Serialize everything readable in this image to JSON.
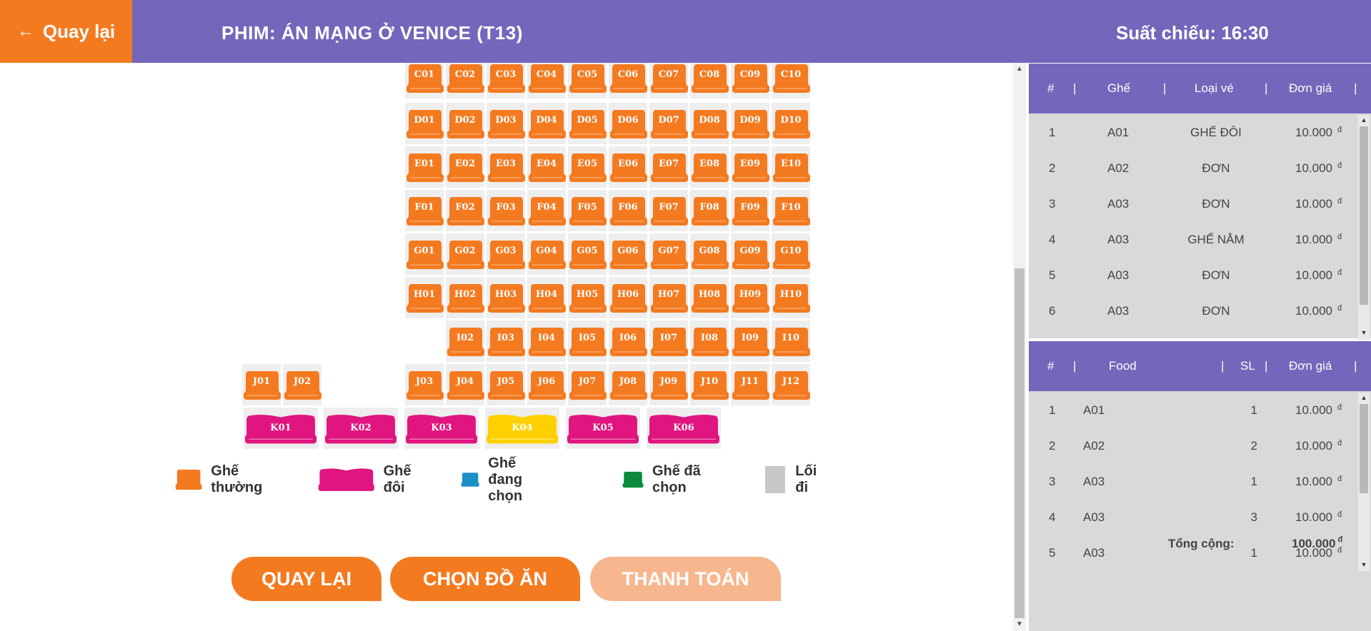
{
  "header": {
    "back_label": "Quay lại",
    "back_icon": "arrow-left-icon",
    "movie_title": "PHIM: ÁN MẠNG Ở VENICE (T13)",
    "showtime": "Suất chiếu: 16:30",
    "colors": {
      "header_bg": "#7466bb",
      "back_bg": "#f47a20"
    }
  },
  "seat_rows": [
    {
      "row": "C",
      "seats": [
        "C01",
        "C02",
        "C03",
        "C04",
        "C05",
        "C06",
        "C07",
        "C08",
        "C09",
        "C10"
      ]
    },
    {
      "row": "D",
      "seats": [
        "D01",
        "D02",
        "D03",
        "D04",
        "D05",
        "D06",
        "D07",
        "D08",
        "D09",
        "D10"
      ]
    },
    {
      "row": "E",
      "seats": [
        "E01",
        "E02",
        "E03",
        "E04",
        "E05",
        "E06",
        "E07",
        "E08",
        "E09",
        "E10"
      ]
    },
    {
      "row": "F",
      "seats": [
        "F01",
        "F02",
        "F03",
        "F04",
        "F05",
        "F06",
        "F07",
        "F08",
        "F09",
        "F10"
      ]
    },
    {
      "row": "G",
      "seats": [
        "G01",
        "G02",
        "G03",
        "G04",
        "G05",
        "G06",
        "G07",
        "G08",
        "G09",
        "G10"
      ]
    },
    {
      "row": "H",
      "seats": [
        "H01",
        "H02",
        "H03",
        "H04",
        "H05",
        "H06",
        "H07",
        "H08",
        "H09",
        "H10"
      ]
    },
    {
      "row": "I",
      "seats": [
        "I02",
        "I03",
        "I04",
        "I05",
        "I06",
        "I07",
        "I08",
        "I09",
        "I10"
      ]
    },
    {
      "row": "J",
      "seats": [
        "J01",
        "J02",
        "J03",
        "J04",
        "J05",
        "J06",
        "J07",
        "J08",
        "J09",
        "J10",
        "J11",
        "J12"
      ]
    }
  ],
  "double_seats": [
    {
      "label": "K01",
      "state": "double"
    },
    {
      "label": "K02",
      "state": "double"
    },
    {
      "label": "K03",
      "state": "double"
    },
    {
      "label": "K04",
      "state": "highlighted"
    },
    {
      "label": "K05",
      "state": "double"
    },
    {
      "label": "K06",
      "state": "double"
    }
  ],
  "legend": {
    "normal": "Ghế thường",
    "double": "Ghế đôi",
    "selecting": "Ghế đang chọn",
    "selected": "Ghế đã chọn",
    "aisle": "Lối đi"
  },
  "colors": {
    "normal": "#f47a20",
    "double": "#e0157f",
    "highlighted": "#ffd000",
    "selecting": "#1e8fc6",
    "selected": "#0a8a3a",
    "aisle": "#c8c8c8",
    "panel_head": "#7466bb",
    "btn_disabled": "#f7b68d"
  },
  "buttons": {
    "back": "QUAY LẠI",
    "food": "CHỌN ĐỒ ĂN",
    "pay": "THANH TOÁN"
  },
  "ticket_table": {
    "headers": [
      "#",
      "Ghế",
      "Loại vé",
      "Đơn giá"
    ],
    "rows": [
      {
        "no": "1",
        "seat": "A01",
        "type": "GHẾ ĐÔI",
        "price": "10.000"
      },
      {
        "no": "2",
        "seat": "A02",
        "type": "ĐƠN",
        "price": "10.000"
      },
      {
        "no": "3",
        "seat": "A03",
        "type": "ĐƠN",
        "price": "10.000"
      },
      {
        "no": "4",
        "seat": "A03",
        "type": "GHẾ NẰM",
        "price": "10.000"
      },
      {
        "no": "5",
        "seat": "A03",
        "type": "ĐƠN",
        "price": "10.000"
      },
      {
        "no": "6",
        "seat": "A03",
        "type": "ĐƠN",
        "price": "10.000"
      }
    ]
  },
  "food_table": {
    "headers": [
      "#",
      "Food",
      "SL",
      "Đơn giá"
    ],
    "rows": [
      {
        "no": "1",
        "food": "A01",
        "qty": "1",
        "price": "10.000"
      },
      {
        "no": "2",
        "food": "A02",
        "qty": "2",
        "price": "10.000"
      },
      {
        "no": "3",
        "food": "A03",
        "qty": "1",
        "price": "10.000"
      },
      {
        "no": "4",
        "food": "A03",
        "qty": "3",
        "price": "10.000"
      },
      {
        "no": "5",
        "food": "A03",
        "qty": "1",
        "price": "10.000"
      }
    ]
  },
  "currency": "đ",
  "total": {
    "label": "Tổng cộng:",
    "value": "100.000"
  }
}
